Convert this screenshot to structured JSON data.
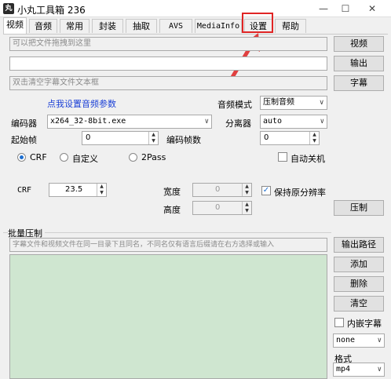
{
  "window": {
    "title": "小丸工具箱 236",
    "app_icon": "丸"
  },
  "tabs": [
    {
      "label": "视频"
    },
    {
      "label": "音频"
    },
    {
      "label": "常用"
    },
    {
      "label": "封装"
    },
    {
      "label": "抽取"
    },
    {
      "label": "AVS"
    },
    {
      "label": "MediaInfo"
    },
    {
      "label": "设置"
    },
    {
      "label": "帮助"
    }
  ],
  "video": {
    "drop_placeholder": "可以把文件拖拽到这里",
    "output_value": "",
    "subtitle_placeholder": "双击清空字幕文件文本框",
    "btn_video": "视频",
    "btn_output": "输出",
    "btn_subtitle": "字幕",
    "audio_params_link": "点我设置音频参数",
    "audio_mode_label": "音频模式",
    "audio_mode_value": "压制音频",
    "encoder_label": "编码器",
    "encoder_value": "x264_32-8bit.exe",
    "splitter_label": "分离器",
    "splitter_value": "auto",
    "start_frame_label": "起始帧",
    "start_frame_value": "0",
    "encode_frames_label": "编码帧数",
    "encode_frames_value": "0",
    "mode_crf": "CRF",
    "mode_custom": "自定义",
    "mode_2pass": "2Pass",
    "auto_shutdown": "自动关机",
    "crf_label": "CRF",
    "crf_value": "23.5",
    "width_label": "宽度",
    "width_value": "0",
    "height_label": "高度",
    "height_value": "0",
    "keep_res": "保持原分辨率",
    "btn_encode": "压制"
  },
  "batch": {
    "group_label": "批量压制",
    "hint_placeholder": "字幕文件和视频文件在同一目录下且同名，不同名仅有语言后缀请在右方选择或输入",
    "btn_output_path": "输出路径",
    "btn_add": "添加",
    "btn_delete": "删除",
    "btn_clear": "清空",
    "embed_sub": "内嵌字幕",
    "sub_select": "none",
    "format_label": "格式",
    "format_select": "mp4"
  }
}
